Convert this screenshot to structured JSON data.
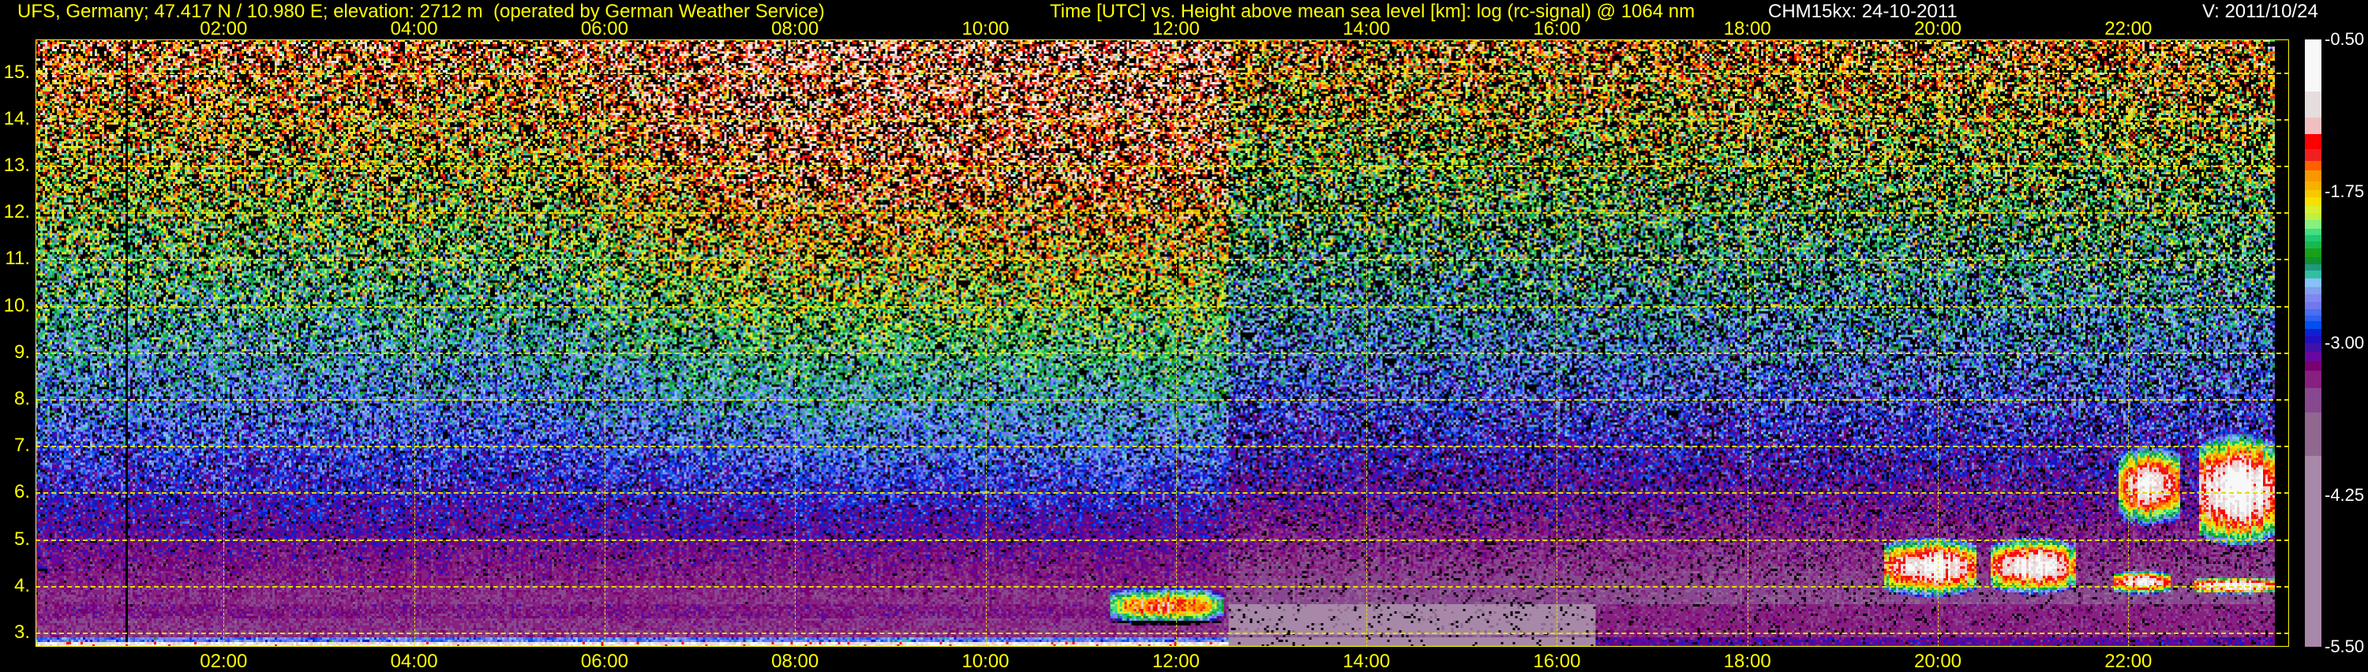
{
  "header": {
    "station": "UFS, Germany; 47.417 N / 10.980 E; elevation: 2712 m  (operated by German Weather Service)",
    "axis_title": "Time [UTC] vs. Height above mean sea level [km]: log (rc-signal) @ 1064 nm",
    "instrument": "CHM15kx: 24-10-2011",
    "version": "V: 2011/10/24"
  },
  "chart_data": {
    "type": "heatmap",
    "title": "Time [UTC] vs. Height above mean sea level [km]: log (rc-signal) @ 1064 nm",
    "xlabel": "Time [UTC]",
    "ylabel": "Height above mean sea level [km]",
    "xlim": [
      0.0,
      23.7
    ],
    "ylim": [
      2.71,
      15.7
    ],
    "x_ticks": [
      "02:00",
      "04:00",
      "06:00",
      "08:00",
      "10:00",
      "12:00",
      "14:00",
      "16:00",
      "18:00",
      "20:00",
      "22:00"
    ],
    "x_tick_hours": [
      2,
      4,
      6,
      8,
      10,
      12,
      14,
      16,
      18,
      20,
      22
    ],
    "y_ticks": [
      "3.",
      "4.",
      "5.",
      "6.",
      "7.",
      "8.",
      "9.",
      "10.",
      "11.",
      "12.",
      "13.",
      "14.",
      "15."
    ],
    "y_tick_km": [
      3,
      4,
      5,
      6,
      7,
      8,
      9,
      10,
      11,
      12,
      13,
      14,
      15
    ],
    "data_end_hour": 23.55,
    "colorbar": {
      "range": [
        -5.5,
        -0.5
      ],
      "labels": [
        "-0.50",
        "-1.75",
        "-3.00",
        "-4.25",
        "-5.50"
      ],
      "label_values": [
        -0.5,
        -1.75,
        -3.0,
        -4.25,
        -5.5
      ],
      "segments": [
        {
          "to": -0.93,
          "color": "#f8f8f8"
        },
        {
          "to": -1.14,
          "color": "#e6dede"
        },
        {
          "to": -1.28,
          "color": "#f0c0c0"
        },
        {
          "to": -1.4,
          "color": "#ff0000"
        },
        {
          "to": -1.5,
          "color": "#f02020"
        },
        {
          "to": -1.58,
          "color": "#ff6000"
        },
        {
          "to": -1.67,
          "color": "#f89800"
        },
        {
          "to": -1.74,
          "color": "#f8b000"
        },
        {
          "to": -1.8,
          "color": "#f8c800"
        },
        {
          "to": -1.87,
          "color": "#f8e000"
        },
        {
          "to": -1.93,
          "color": "#d8f030"
        },
        {
          "to": -1.99,
          "color": "#c0f040"
        },
        {
          "to": -2.06,
          "color": "#88f080"
        },
        {
          "to": -2.11,
          "color": "#40e080"
        },
        {
          "to": -2.16,
          "color": "#20c870"
        },
        {
          "to": -2.22,
          "color": "#18b850"
        },
        {
          "to": -2.29,
          "color": "#18a018"
        },
        {
          "to": -2.35,
          "color": "#109030"
        },
        {
          "to": -2.4,
          "color": "#209880"
        },
        {
          "to": -2.47,
          "color": "#30c0a0"
        },
        {
          "to": -2.54,
          "color": "#88c0f8"
        },
        {
          "to": -2.6,
          "color": "#80a0f0"
        },
        {
          "to": -2.66,
          "color": "#8088f0"
        },
        {
          "to": -2.72,
          "color": "#7078f0"
        },
        {
          "to": -2.77,
          "color": "#4870f0"
        },
        {
          "to": -2.82,
          "color": "#3060f0"
        },
        {
          "to": -2.88,
          "color": "#0050f0"
        },
        {
          "to": -2.94,
          "color": "#1020d0"
        },
        {
          "to": -3.0,
          "color": "#2010c0"
        },
        {
          "to": -3.07,
          "color": "#4010a8"
        },
        {
          "to": -3.15,
          "color": "#6808a0"
        },
        {
          "to": -3.23,
          "color": "#780070"
        },
        {
          "to": -3.37,
          "color": "#882080"
        },
        {
          "to": -3.57,
          "color": "#884890"
        },
        {
          "to": -3.93,
          "color": "#906890"
        },
        {
          "to": -5.5,
          "color": "#a888a8"
        }
      ]
    },
    "cloud_features": [
      {
        "t0": 11.3,
        "t1": 12.5,
        "h0": 3.2,
        "h1": 3.95,
        "peak": -1.35
      },
      {
        "t0": 19.45,
        "t1": 20.4,
        "h0": 3.85,
        "h1": 4.95,
        "peak": -0.8
      },
      {
        "t0": 20.55,
        "t1": 21.45,
        "h0": 3.9,
        "h1": 4.95,
        "peak": -0.8
      },
      {
        "t0": 21.85,
        "t1": 22.45,
        "h0": 3.85,
        "h1": 4.3,
        "peak": -0.9
      },
      {
        "t0": 22.7,
        "t1": 23.55,
        "h0": 3.85,
        "h1": 4.15,
        "peak": -0.6
      },
      {
        "t0": 21.9,
        "t1": 22.55,
        "h0": 5.4,
        "h1": 6.9,
        "peak": -0.9
      },
      {
        "t0": 22.75,
        "t1": 23.55,
        "h0": 5.0,
        "h1": 7.1,
        "peak": -0.6
      }
    ]
  }
}
